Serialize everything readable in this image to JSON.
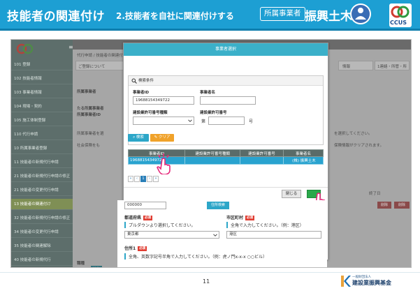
{
  "slide": {
    "title": "技能者の関連付け",
    "subtitle": "2.技能者を自社に関連付けする",
    "role_badge": "所属事業者",
    "company_name": "振興土木",
    "page_number": "11",
    "footer_org_small": "一般財団法人",
    "footer_org": "建設業振興基金",
    "ccus_label": "CCUS"
  },
  "sidebar": {
    "menu_icon": "≡",
    "items": [
      {
        "label": "101 登録"
      },
      {
        "label": "102 技能者情報"
      },
      {
        "label": "103 事業者情報"
      },
      {
        "label": "104 現場・契約"
      },
      {
        "label": "105 施工体制登録"
      },
      {
        "label": "110 代行申請"
      },
      {
        "label": "10 所属事業者登録"
      },
      {
        "label": "11 技能者の新規代行申請"
      },
      {
        "label": "21 技能者の新規代行申請の修正"
      },
      {
        "label": "21 技能者の変更代行申請"
      },
      {
        "label": "13 技能者の関連付け",
        "active": true
      },
      {
        "label": "32 技能者の新規代行申請の修正"
      },
      {
        "label": "34 技能者の変更代行申請"
      },
      {
        "label": "35 技能者の関連解除"
      },
      {
        "label": "40 技能者の新規代行"
      }
    ]
  },
  "background": {
    "breadcrumb": "代行申請 / 技能者の関連付け",
    "notice": "ご登録について",
    "section_company": "所属事業者",
    "section_company_id": "たる所属事業者",
    "section_company_id2": "所属事業者ID",
    "hint1": "所属事業者を選",
    "hint2": "社会保険をも",
    "hint_right1": "を選択してください。",
    "hint_right2": "保険情報がクリアされます。",
    "right_tab1": "情報",
    "right_tab2": "1連絡・所管・所",
    "end_date": "終了日",
    "label_type": "職種",
    "btn_red": "削除",
    "btn_teal": "技能"
  },
  "modal": {
    "title": "事業者選択",
    "search_header": "検索条件",
    "label_company_id": "事業者ID",
    "label_company_name": "事業者名",
    "value_company_id": "19688154349722",
    "value_company_name": "",
    "label_license_type": "建設業許可番号種類",
    "label_license_no": "建設業許可番号",
    "license_prefix": "第",
    "license_suffix": "号",
    "btn_search": "検索",
    "btn_clear": "クリア",
    "table": {
      "headers": [
        "事業者ID",
        "建設業許可番号種類",
        "建設業許可番号",
        "事業者名"
      ],
      "rows": [
        [
          "19688154349722",
          "",
          "",
          "(株) 振興土木"
        ]
      ]
    },
    "pager": [
      "«",
      "‹",
      "1",
      "›",
      "»"
    ],
    "pager_active": "1",
    "btn_close": "閉じる",
    "btn_select": ""
  },
  "lower_form": {
    "postal_value": "000000",
    "postal_btn": "住所検索",
    "pref_label": "都道府県",
    "city_label": "市区町村",
    "required": "必須",
    "pref_help": "プルダウンより選択してください。",
    "city_help": "全角で入力してください。（例：港区）",
    "pref_value": "東京都",
    "city_value": "港区",
    "addr_label": "住所1",
    "addr_help": "全角、英数字記号半角で入力してください。（例：虎ノ門x-x-x ○○ビル）"
  },
  "colors": {
    "header_blue": "#1d9fd3",
    "modal_teal": "#3bb0c9",
    "selected_row": "#29a3cf",
    "search_btn": "#2ca6c8",
    "clear_btn": "#f0a22a",
    "select_btn": "#2aa84a",
    "pointer_pink": "#e6287a"
  }
}
